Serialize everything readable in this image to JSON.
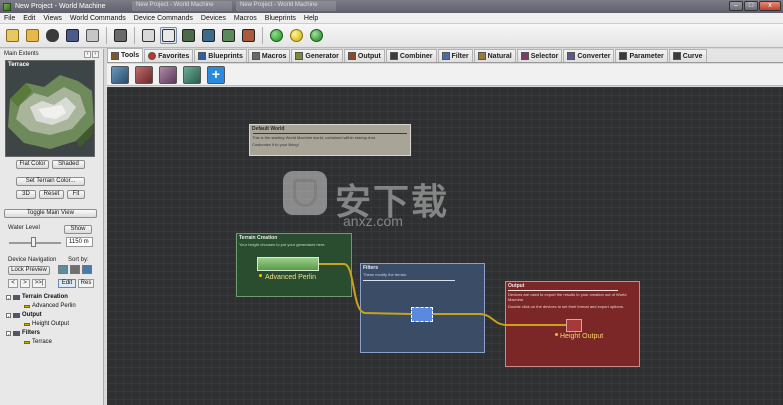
{
  "window": {
    "title": "New Project - World Machine",
    "ghost_tabs": [
      "New Project - World Machine",
      "New Project - World Machine"
    ],
    "minimize_glyph": "–",
    "maximize_glyph": "□",
    "close_glyph": "x"
  },
  "menu": [
    "File",
    "Edit",
    "Views",
    "World Commands",
    "Device Commands",
    "Devices",
    "Macros",
    "Blueprints",
    "Help"
  ],
  "toolbar": {
    "icons": [
      "new-file-icon",
      "open-folder-icon",
      "wizard-icon",
      "save-icon",
      "edit-icon",
      "render-icon",
      "layout-view-icon",
      "device-view-icon",
      "terrain-view-icon",
      "explorer-icon",
      "texture-view-icon",
      "build-green-icon",
      "build-yellow-icon",
      "build-global-icon"
    ],
    "colors": {
      "green": "#2faa2f",
      "yellow": "#e3c800",
      "global": "#2f9a2f"
    }
  },
  "left_panel": {
    "main_extents_label": "Main Extents",
    "preview_label": "Terrace",
    "flat_color_button": "Flat Color",
    "shaded_button": "Shaded",
    "set_terrain_color_button": "Set Terrain Color...",
    "view_3d_button": "3D",
    "reset_button": "Reset",
    "fit_button": "Fit",
    "toggle_main_view_button": "Toggle Main View",
    "water_level_label": "Water Level",
    "show_button": "Show",
    "water_level_value": "1150 m",
    "device_navigation_label": "Device Navigation",
    "sort_by_label": "Sort by:",
    "lock_preview_button": "Lock Preview",
    "nav_prev": "<",
    "nav_next": ">",
    "nav_last": ">>|",
    "edit_button": "Edit",
    "res_button": "Res",
    "tree": [
      {
        "label": "Terrain Creation",
        "level": 0,
        "expander": "-"
      },
      {
        "label": "Advanced Perlin",
        "level": 1
      },
      {
        "label": "Output",
        "level": 0,
        "expander": "-"
      },
      {
        "label": "Height Output",
        "level": 1
      },
      {
        "label": "Filters",
        "level": 0,
        "expander": "-"
      },
      {
        "label": "Terrace",
        "level": 1
      }
    ]
  },
  "tabs": [
    {
      "label": "Tools",
      "icon": "tools-icon",
      "color": "#7a5a2a"
    },
    {
      "label": "Favorites",
      "icon": "heart-icon",
      "color": "#c8302a"
    },
    {
      "label": "Blueprints",
      "icon": "blueprint-icon",
      "color": "#2a5fa8"
    },
    {
      "label": "Macros",
      "icon": "macro-icon",
      "color": "#6a6a6a"
    },
    {
      "label": "Generator",
      "icon": "generator-icon",
      "color": "#7a8a3a"
    },
    {
      "label": "Output",
      "icon": "output-icon",
      "color": "#8a4a2a"
    },
    {
      "label": "Combiner",
      "icon": "combiner-icon",
      "color": "#3a3a3a"
    },
    {
      "label": "Filter",
      "icon": "filter-icon",
      "color": "#4a6aa8"
    },
    {
      "label": "Natural",
      "icon": "natural-icon",
      "color": "#9a7a3a"
    },
    {
      "label": "Selector",
      "icon": "selector-icon",
      "color": "#7a3a6a"
    },
    {
      "label": "Converter",
      "icon": "converter-icon",
      "color": "#5a5a8a"
    },
    {
      "label": "Parameter",
      "icon": "parameter-icon",
      "color": "#3a3a3a"
    },
    {
      "label": "Curve",
      "icon": "curve-icon",
      "color": "#3a3a3a"
    }
  ],
  "tool_icons": [
    {
      "name": "group-tool-icon",
      "color": "#4a7aa0"
    },
    {
      "name": "route-tool-icon",
      "color": "#a04a4a"
    },
    {
      "name": "comment-tool-icon",
      "color": "#8a5a7a"
    },
    {
      "name": "macro-tool-icon",
      "color": "#4a8a6a"
    },
    {
      "name": "add-tool-icon",
      "color": "#2a8ae0"
    }
  ],
  "canvas": {
    "default_world": {
      "title": "Default World",
      "lines": [
        "This is the starting World Machine world, contained within startup.tmd.",
        "Customize it to your liking!"
      ]
    },
    "terrain_creation": {
      "title": "Terrain Creation",
      "desc": "Your height chooses to put your generators here.",
      "node_label": "Advanced Perlin"
    },
    "filters": {
      "title": "Filters",
      "desc": "These modify the terrain."
    },
    "output": {
      "title": "Output",
      "desc": "Devices are used to export the results to your creation out of World Machine.",
      "desc2": "Double click on the devices to set their format and export options.",
      "node_label": "Height Output"
    },
    "watermark": {
      "cn": "安下载",
      "en": "anxz.com"
    },
    "colors": {
      "wire": "#c9a21a",
      "green_group": "#2b4d2f",
      "blue_group": "#3b4c67",
      "red_group": "#7b2727",
      "note_group": "#a9a59a"
    }
  }
}
